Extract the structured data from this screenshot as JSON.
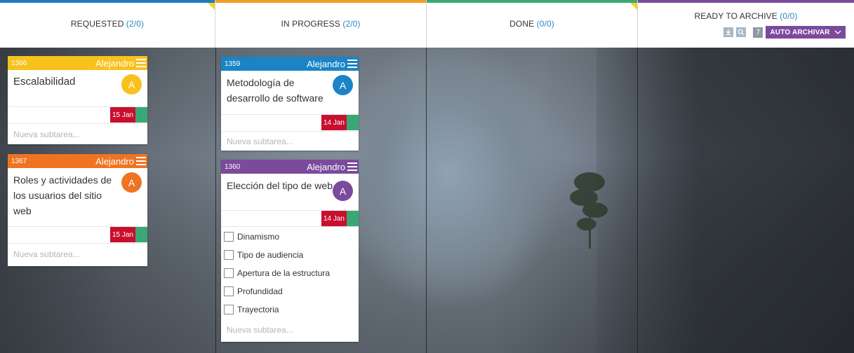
{
  "colors": {
    "requested": "#1e7bc0",
    "in_progress": "#f29e21",
    "done": "#3aa876",
    "ready_to_archive": "#7b4a9c",
    "card_yellow": "#f8c21e",
    "card_orange": "#ef7422",
    "card_blue": "#1a84c6",
    "card_purple": "#7b4a9c",
    "date_red": "#c8102e",
    "date_green": "#3aa876"
  },
  "columns": [
    {
      "title": "REQUESTED",
      "count": "(2/0)"
    },
    {
      "title": "IN PROGRESS",
      "count": "(2/0)"
    },
    {
      "title": "DONE",
      "count": "(0/0)"
    },
    {
      "title": "READY TO ARCHIVE",
      "count": "(0/0)"
    }
  ],
  "archive_tools": {
    "number": "7",
    "auto_label": "AUTO ARCHIVAR",
    "icons": [
      "download-icon",
      "search-icon",
      "chevron-down-icon"
    ]
  },
  "cards": [
    {
      "id": "1366",
      "assignee": "Alejandro",
      "title": "Escalabilidad",
      "avatar": "A",
      "date": "15 Jan",
      "subtask_placeholder": "Nueva subtarea..."
    },
    {
      "id": "1367",
      "assignee": "Alejandro",
      "title_lines": [
        "Roles y actividades de",
        "los usuarios del sitio",
        "web"
      ],
      "avatar": "A",
      "date": "15 Jan",
      "subtask_placeholder": "Nueva subtarea..."
    },
    {
      "id": "1359",
      "assignee": "Alejandro",
      "title_lines": [
        "Metodología de",
        "desarrollo de software"
      ],
      "avatar": "A",
      "date": "14 Jan",
      "subtask_placeholder": "Nueva subtarea..."
    },
    {
      "id": "1360",
      "assignee": "Alejandro",
      "title": "Elección del tipo de web",
      "avatar": "A",
      "date": "14 Jan",
      "subtasks": [
        "Dinamismo",
        "Tipo de audiencia",
        "Apertura de la estructura",
        "Profundidad",
        "Trayectoria"
      ],
      "subtask_placeholder": "Nueva subtarea..."
    }
  ]
}
